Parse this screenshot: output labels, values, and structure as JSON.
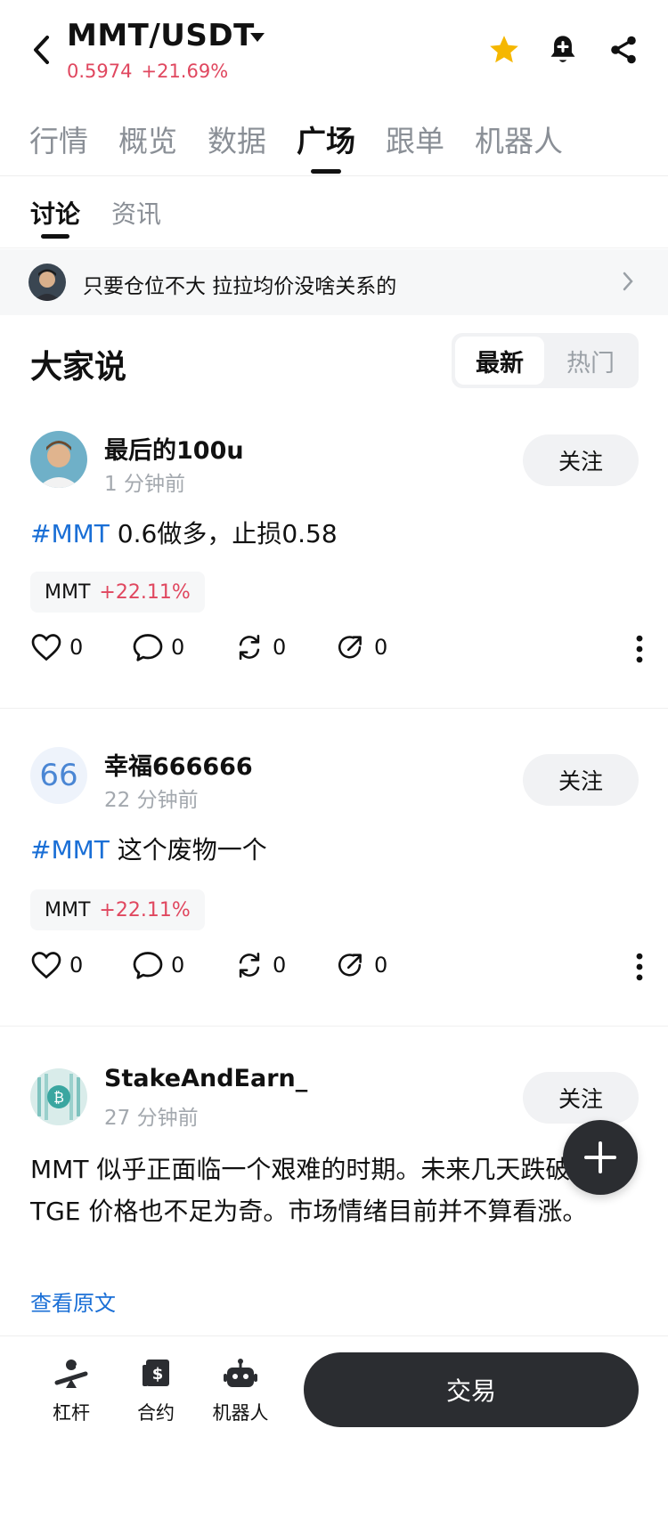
{
  "header": {
    "pair": "MMT/USDT",
    "price": "0.5974",
    "change": "+21.69%"
  },
  "tabs": [
    "行情",
    "概览",
    "数据",
    "广场",
    "跟单",
    "机器人"
  ],
  "active_tab": "广场",
  "subtabs": [
    "讨论",
    "资讯"
  ],
  "banner": {
    "text": "只要仓位不大 拉拉均价没啥关系的"
  },
  "section": {
    "title": "大家说",
    "seg_latest": "最新",
    "seg_hot": "热门"
  },
  "posts": [
    {
      "author": "最后的100u",
      "time": "1 分钟前",
      "follow": "关注",
      "hashtag": "#MMT",
      "text": " 0.6做多，止损0.58",
      "coin": "MMT",
      "coin_change": "+22.11%",
      "likes": "0",
      "comments": "0",
      "reposts": "0",
      "shares": "0"
    },
    {
      "author": "幸福666666",
      "avatar_text": "66",
      "time": "22 分钟前",
      "follow": "关注",
      "hashtag": "#MMT",
      "text": " 这个废物一个",
      "coin": "MMT",
      "coin_change": "+22.11%",
      "likes": "0",
      "comments": "0",
      "reposts": "0",
      "shares": "0"
    },
    {
      "author": "StakeAndEarn_",
      "time": "27 分钟前",
      "follow": "关注",
      "text": "MMT 似乎正面临一个艰难的时期。未来几天跌破其 TGE 价格也不足为奇。市场情绪目前并不算看涨。",
      "view_original": "查看原文"
    }
  ],
  "bottom_bar": {
    "leverage": "杠杆",
    "contract": "合约",
    "robot": "机器人",
    "trade": "交易"
  },
  "colors": {
    "up": "#e0475f",
    "link": "#1a6fd6",
    "star": "#f5b700",
    "dark": "#2b2d31"
  }
}
